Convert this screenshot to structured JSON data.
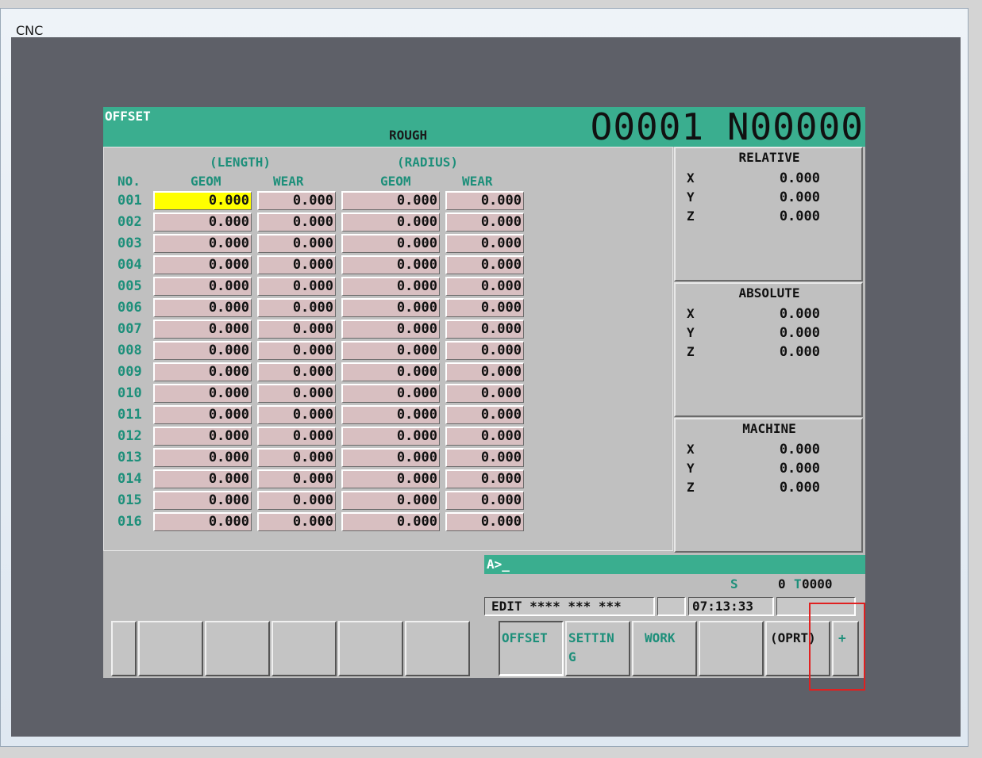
{
  "window": {
    "title": "CNC"
  },
  "header": {
    "title": "OFFSET",
    "mode": "ROUGH",
    "program": "O0001 N00000"
  },
  "offset_table": {
    "group_length": "(LENGTH)",
    "group_radius": "(RADIUS)",
    "col_no": "NO.",
    "col_geom": "GEOM",
    "col_wear": "WEAR",
    "rows": [
      {
        "no": "001",
        "lg": "0.000",
        "lw": "0.000",
        "rg": "0.000",
        "rw": "0.000"
      },
      {
        "no": "002",
        "lg": "0.000",
        "lw": "0.000",
        "rg": "0.000",
        "rw": "0.000"
      },
      {
        "no": "003",
        "lg": "0.000",
        "lw": "0.000",
        "rg": "0.000",
        "rw": "0.000"
      },
      {
        "no": "004",
        "lg": "0.000",
        "lw": "0.000",
        "rg": "0.000",
        "rw": "0.000"
      },
      {
        "no": "005",
        "lg": "0.000",
        "lw": "0.000",
        "rg": "0.000",
        "rw": "0.000"
      },
      {
        "no": "006",
        "lg": "0.000",
        "lw": "0.000",
        "rg": "0.000",
        "rw": "0.000"
      },
      {
        "no": "007",
        "lg": "0.000",
        "lw": "0.000",
        "rg": "0.000",
        "rw": "0.000"
      },
      {
        "no": "008",
        "lg": "0.000",
        "lw": "0.000",
        "rg": "0.000",
        "rw": "0.000"
      },
      {
        "no": "009",
        "lg": "0.000",
        "lw": "0.000",
        "rg": "0.000",
        "rw": "0.000"
      },
      {
        "no": "010",
        "lg": "0.000",
        "lw": "0.000",
        "rg": "0.000",
        "rw": "0.000"
      },
      {
        "no": "011",
        "lg": "0.000",
        "lw": "0.000",
        "rg": "0.000",
        "rw": "0.000"
      },
      {
        "no": "012",
        "lg": "0.000",
        "lw": "0.000",
        "rg": "0.000",
        "rw": "0.000"
      },
      {
        "no": "013",
        "lg": "0.000",
        "lw": "0.000",
        "rg": "0.000",
        "rw": "0.000"
      },
      {
        "no": "014",
        "lg": "0.000",
        "lw": "0.000",
        "rg": "0.000",
        "rw": "0.000"
      },
      {
        "no": "015",
        "lg": "0.000",
        "lw": "0.000",
        "rg": "0.000",
        "rw": "0.000"
      },
      {
        "no": "016",
        "lg": "0.000",
        "lw": "0.000",
        "rg": "0.000",
        "rw": "0.000"
      }
    ]
  },
  "positions": {
    "relative": {
      "title": "RELATIVE",
      "x": "0.000",
      "y": "0.000",
      "z": "0.000"
    },
    "absolute": {
      "title": "ABSOLUTE",
      "x": "0.000",
      "y": "0.000",
      "z": "0.000"
    },
    "machine": {
      "title": "MACHINE",
      "x": "0.000",
      "y": "0.000",
      "z": "0.000"
    },
    "axis_x": "X",
    "axis_y": "Y",
    "axis_z": "Z"
  },
  "input": {
    "prompt": "A>_"
  },
  "spindle": {
    "s_label": "S",
    "s_value": "0",
    "t_label": "T",
    "t_value": "0000"
  },
  "status": {
    "mode": "EDIT **** *** ***",
    "time": "07:13:33"
  },
  "softkeys": [
    {
      "label": "OFFSET"
    },
    {
      "label": "SETTIN\nG"
    },
    {
      "label": "WORK"
    },
    {
      "label": ""
    },
    {
      "label": "(OPRT)"
    },
    {
      "label": "+"
    }
  ]
}
